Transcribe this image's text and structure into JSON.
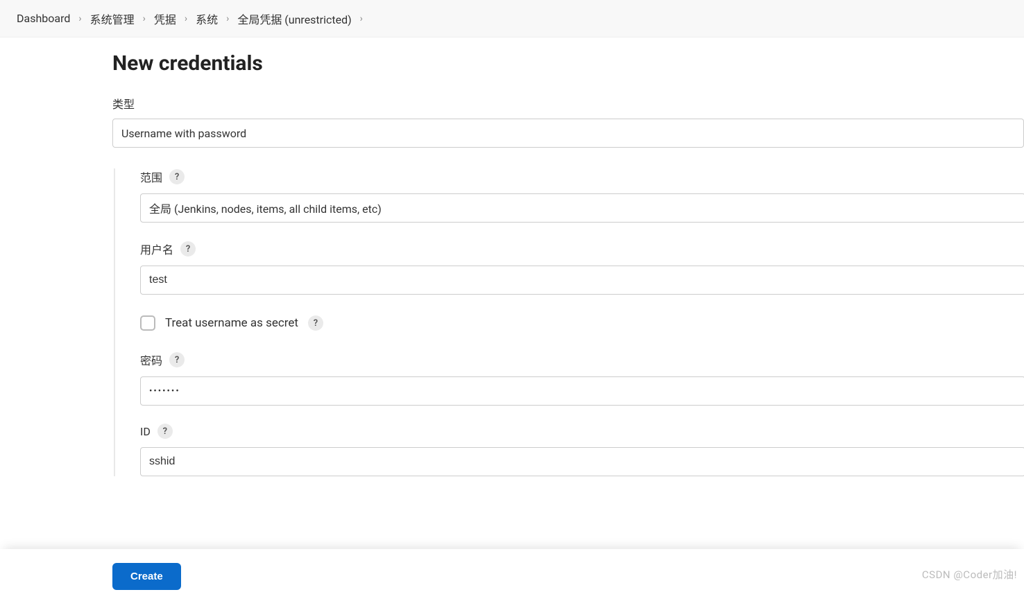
{
  "breadcrumb": {
    "items": [
      "Dashboard",
      "系统管理",
      "凭据",
      "系统",
      "全局凭据 (unrestricted)"
    ]
  },
  "page": {
    "title": "New credentials"
  },
  "form": {
    "kind_label": "类型",
    "kind_value": "Username with password",
    "scope_label": "范围",
    "scope_value": "全局 (Jenkins, nodes, items, all child items, etc)",
    "username_label": "用户名",
    "username_value": "test",
    "treat_secret_label": "Treat username as secret",
    "password_label": "密码",
    "password_value": "•••••••",
    "id_label": "ID",
    "id_value": "sshid"
  },
  "buttons": {
    "create": "Create"
  },
  "watermark": "CSDN @Coder加油!"
}
